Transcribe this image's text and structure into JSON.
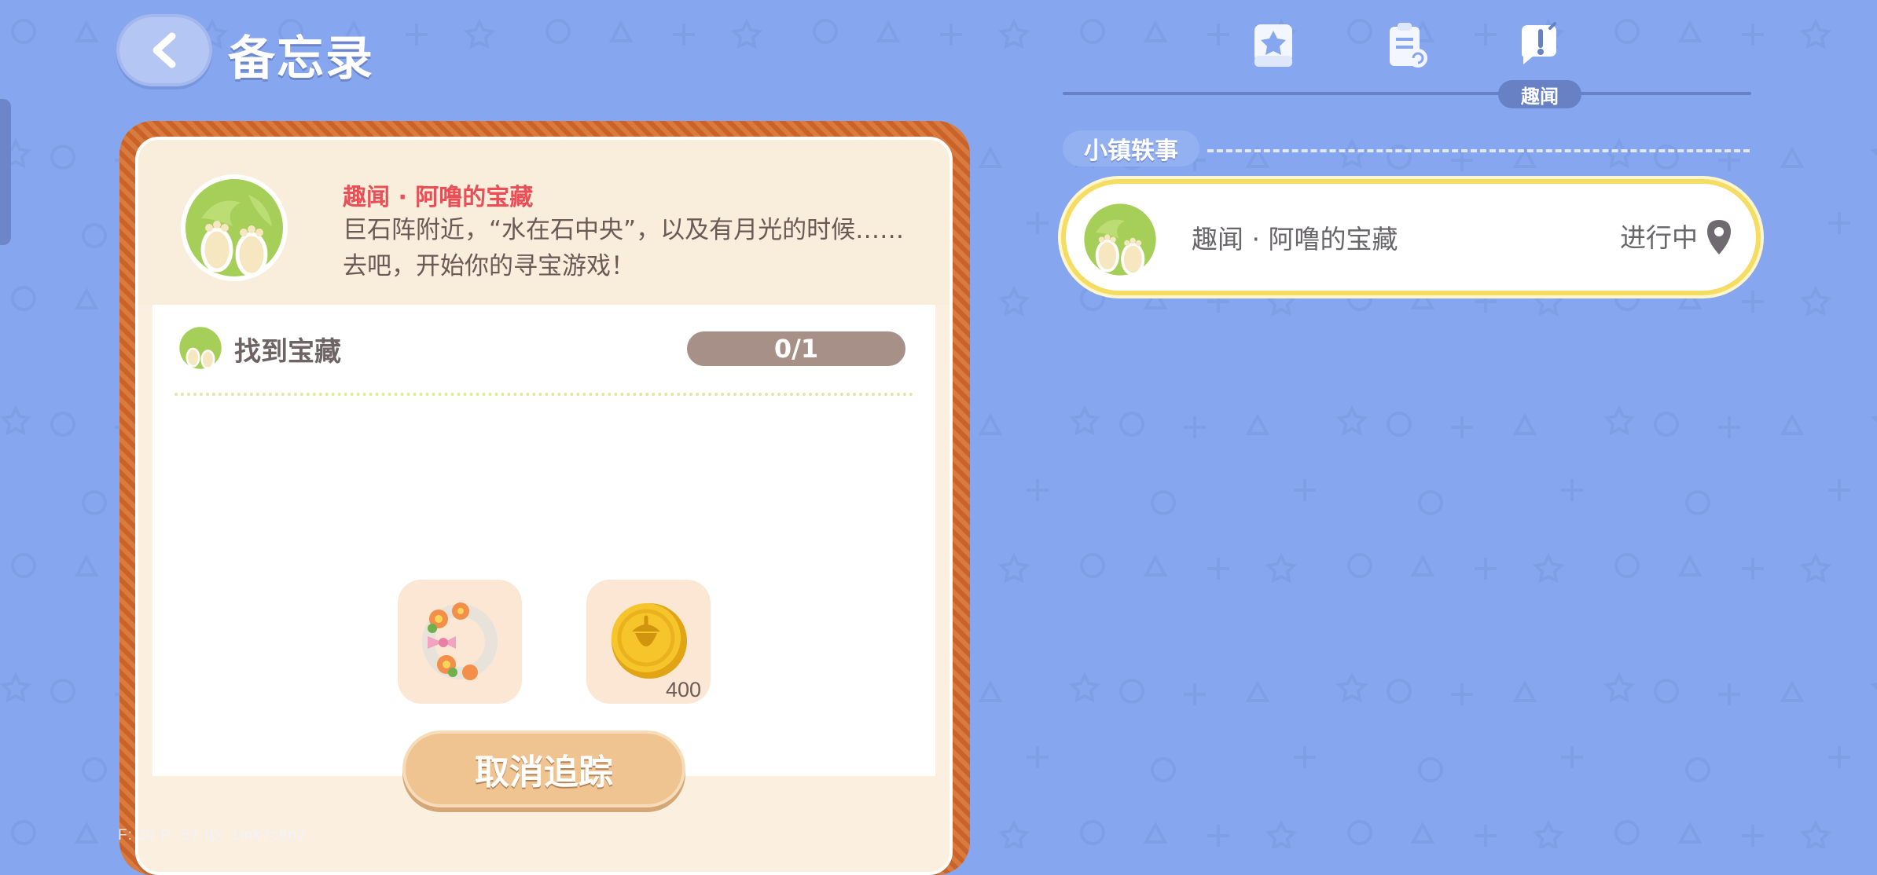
{
  "header": {
    "title": "备忘录"
  },
  "tabs": {
    "items": [
      {
        "name": "tab-book",
        "label": ""
      },
      {
        "name": "tab-clipboard",
        "label": ""
      },
      {
        "name": "tab-news",
        "label": "趣闻",
        "active": true
      }
    ],
    "active_label": "趣闻"
  },
  "quest": {
    "title": "趣闻 · 阿噜的宝藏",
    "description": "巨石阵附近，“水在石中央”，以及有月光的时候……去吧，开始你的寻宝游戏！",
    "objective": {
      "text": "找到宝藏",
      "progress": "0/1"
    },
    "rewards": [
      {
        "icon": "flower-wreath-icon",
        "count": ""
      },
      {
        "icon": "acorn-coin-icon",
        "count": "400"
      }
    ],
    "cancel_label": "取消追踪"
  },
  "list": {
    "section_title": "小镇轶事",
    "items": [
      {
        "title": "趣闻 · 阿噜的宝藏",
        "status": "进行中"
      }
    ]
  },
  "debug_text": "F: 30    P: 57    ID: 1mk7c8n2",
  "colors": {
    "background": "#86a7ef",
    "card_border": "#cf6b2e",
    "quest_title": "#ea4f57",
    "highlight_border": "#f5dc63",
    "button": "#efc491"
  }
}
